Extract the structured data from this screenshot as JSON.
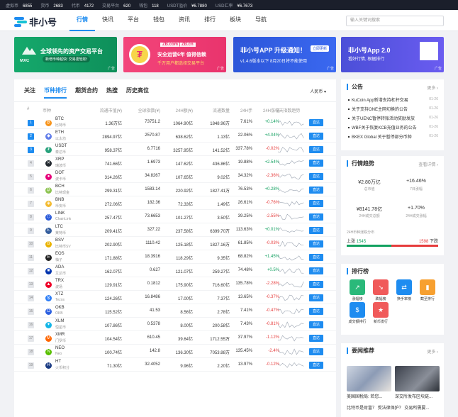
{
  "topbar": [
    {
      "label": "虚拟币",
      "value": "6855"
    },
    {
      "label": "货币",
      "value": "2683"
    },
    {
      "label": "代币",
      "value": "4172"
    },
    {
      "label": "交易平台",
      "value": "620"
    },
    {
      "label": "钱包",
      "value": "118"
    },
    {
      "label": "USDT溢价",
      "value": "¥6.7880"
    },
    {
      "label": "USD汇率",
      "value": "¥6.7673"
    }
  ],
  "logo": "非小号",
  "nav": [
    "行情",
    "快讯",
    "平台",
    "钱包",
    "资讯",
    "排行",
    "板块",
    "导航"
  ],
  "search_placeholder": "输入关键词搜索",
  "banners": {
    "b1": {
      "brand": "MXC",
      "title": "全球领先的资产交易平台",
      "sub": "新增币种超快! 交易更轻松!",
      "ad": "广告"
    },
    "b2": {
      "brand": "ZB.com | ZB.cn",
      "title": "安全运营6年 值得信赖",
      "sub": "千万用户都选择交易平台",
      "ad": "广告"
    },
    "b3": {
      "title": "非小号APP 升级通知！",
      "sub": "v1.4.6版本以下 8月20日将不能使用",
      "btn": "立即更新",
      "ad": "广告"
    },
    "b4": {
      "title": "非小号App 2.0",
      "sub": "看好行情, 根据排行",
      "ad": "广告"
    }
  },
  "tabs": [
    "关注",
    "币种排行",
    "期货合约",
    "热搜",
    "历史高位"
  ],
  "currency": "人民币",
  "headers": [
    "#",
    "币种",
    "流通市值(¥)",
    "全球指数(¥)",
    "24H额(¥)",
    "流通数量",
    "24H手",
    "24H涨幅",
    "7天指数趋势"
  ],
  "go_label": "直达",
  "rows": [
    {
      "rank": "1",
      "sym": "BTC",
      "name": "比特币",
      "cap": "1.36万亿",
      "price": "73751.2",
      "vol": "1064.90亿",
      "supply": "1848.96万",
      "turn": "7.61%",
      "chg": "+0.14%",
      "dir": "up",
      "color": "#f7931a",
      "ico": "₿"
    },
    {
      "rank": "2",
      "sym": "ETH",
      "name": "以太坊",
      "cap": "2894.97亿",
      "price": "2570.87",
      "vol": "638.62亿",
      "supply": "1.13亿",
      "turn": "22.06%",
      "chg": "+4.04%",
      "dir": "up",
      "color": "#627eea",
      "ico": "◆"
    },
    {
      "rank": "3",
      "sym": "USDT",
      "name": "泰达币",
      "cap": "958.37亿",
      "price": "6.7716",
      "vol": "3257.95亿",
      "supply": "141.52亿",
      "turn": "337.78%",
      "chg": "-0.02%",
      "dir": "down",
      "color": "#26a17b",
      "ico": "₮"
    },
    {
      "rank": "4",
      "sym": "XRP",
      "name": "瑞波币",
      "cap": "741.66亿",
      "price": "1.6973",
      "vol": "147.62亿",
      "supply": "436.86亿",
      "turn": "19.88%",
      "chg": "+2.54%",
      "dir": "up",
      "color": "#23292f",
      "ico": "✕"
    },
    {
      "rank": "5",
      "sym": "DOT",
      "name": "波卡币",
      "cap": "314.26亿",
      "price": "34.8267",
      "vol": "107.65亿",
      "supply": "9.02亿",
      "turn": "34.32%",
      "chg": "-2.36%",
      "dir": "down",
      "color": "#e6007a",
      "ico": "●"
    },
    {
      "rank": "6",
      "sym": "BCH",
      "name": "比特现金",
      "cap": "299.31亿",
      "price": "1583.14",
      "vol": "220.92亿",
      "supply": "1827.41万",
      "turn": "76.53%",
      "chg": "+0.28%",
      "dir": "up",
      "color": "#8dc351",
      "ico": "₿"
    },
    {
      "rank": "7",
      "sym": "BNB",
      "name": "币安币",
      "cap": "272.06亿",
      "price": "182.36",
      "vol": "72.33亿",
      "supply": "1.49亿",
      "turn": "26.61%",
      "chg": "-0.76%",
      "dir": "down",
      "color": "#f3ba2f",
      "ico": "◈"
    },
    {
      "rank": "8",
      "sym": "LINK",
      "name": "ChainLink",
      "cap": "257.47亿",
      "price": "73.6653",
      "vol": "101.27亿",
      "supply": "3.50亿",
      "turn": "39.25%",
      "chg": "-2.55%",
      "dir": "down",
      "color": "#2a5ada",
      "ico": "⬡"
    },
    {
      "rank": "9",
      "sym": "LTC",
      "name": "莱特币",
      "cap": "209.41亿",
      "price": "327.22",
      "vol": "237.58亿",
      "supply": "6399.70万",
      "turn": "113.63%",
      "chg": "+0.01%",
      "dir": "up",
      "color": "#345d9d",
      "ico": "Ł"
    },
    {
      "rank": "10",
      "sym": "BSV",
      "name": "比特币SV",
      "cap": "202.90亿",
      "price": "1110.42",
      "vol": "125.18亿",
      "supply": "1827.16万",
      "turn": "61.85%",
      "chg": "-0.03%",
      "dir": "down",
      "color": "#eab300",
      "ico": "B"
    },
    {
      "rank": "11",
      "sym": "EOS",
      "name": "柚子",
      "cap": "171.88亿",
      "price": "18.3916",
      "vol": "118.29亿",
      "supply": "9.35亿",
      "turn": "68.82%",
      "chg": "+1.45%",
      "dir": "up",
      "color": "#222",
      "ico": "E"
    },
    {
      "rank": "12",
      "sym": "ADA",
      "name": "艾达币",
      "cap": "162.07亿",
      "price": "0.627",
      "vol": "121.07亿",
      "supply": "259.27亿",
      "turn": "74.48%",
      "chg": "+0.5%",
      "dir": "up",
      "color": "#0033ad",
      "ico": "✺"
    },
    {
      "rank": "13",
      "sym": "TRX",
      "name": "波场",
      "cap": "129.91亿",
      "price": "0.1812",
      "vol": "175.90亿",
      "supply": "716.60亿",
      "turn": "135.78%",
      "chg": "-2.28%",
      "dir": "down",
      "color": "#ef0027",
      "ico": "▲"
    },
    {
      "rank": "14",
      "sym": "XTZ",
      "name": "Tezos",
      "cap": "124.26亿",
      "price": "16.8486",
      "vol": "17.00亿",
      "supply": "7.37亿",
      "turn": "13.65%",
      "chg": "-0.37%",
      "dir": "down",
      "color": "#2c7df7",
      "ico": "ꜩ"
    },
    {
      "rank": "15",
      "sym": "OKB",
      "name": "OKB",
      "cap": "115.52亿",
      "price": "41.53",
      "vol": "8.56亿",
      "supply": "2.78亿",
      "turn": "7.41%",
      "chg": "-0.47%",
      "dir": "down",
      "color": "#2d60e0",
      "ico": "O"
    },
    {
      "rank": "16",
      "sym": "XLM",
      "name": "恒星币",
      "cap": "107.86亿",
      "price": "0.5378",
      "vol": "8.00亿",
      "supply": "200.58亿",
      "turn": "7.43%",
      "chg": "-0.81%",
      "dir": "down",
      "color": "#14b6e7",
      "ico": "✦"
    },
    {
      "rank": "17",
      "sym": "XMR",
      "name": "门罗币",
      "cap": "104.54亿",
      "price": "610.45",
      "vol": "39.64亿",
      "supply": "1712.55万",
      "turn": "37.97%",
      "chg": "-1.12%",
      "dir": "down",
      "color": "#ff6600",
      "ico": "M"
    },
    {
      "rank": "18",
      "sym": "NEO",
      "name": "Neo",
      "cap": "100.74亿",
      "price": "142.8",
      "vol": "136.30亿",
      "supply": "7053.88万",
      "turn": "135.45%",
      "chg": "-2.4%",
      "dir": "down",
      "color": "#58bf00",
      "ico": "N"
    },
    {
      "rank": "19",
      "sym": "HT",
      "name": "火币积分",
      "cap": "71.30亿",
      "price": "32.4052",
      "vol": "9.96亿",
      "supply": "2.20亿",
      "turn": "13.97%",
      "chg": "-0.12%",
      "dir": "down",
      "color": "#1c3c84",
      "ico": "H"
    }
  ],
  "announce": {
    "title": "公告",
    "more": "更多",
    "items": [
      {
        "text": "KuCoin App新增支持杠杆交易",
        "date": "01-26"
      },
      {
        "text": "关于支持ONE主网切换的公告",
        "date": "01-26"
      },
      {
        "text": "关于UENC暂停转账活动奖励发放",
        "date": "01-26"
      },
      {
        "text": "WBF关于恢复KCB充值业务的公告",
        "date": "01-26"
      },
      {
        "text": "BKEX Global 关于暂停部分币种",
        "date": "01-26"
      }
    ]
  },
  "market": {
    "title": "行情趋势",
    "more": "查看详情",
    "m1": {
      "value": "¥2.80万亿",
      "label": "总市值"
    },
    "m2": {
      "value": "+16.46%",
      "label": "7日涨幅"
    },
    "m3": {
      "value": "¥8141.78亿",
      "label": "24H成交总额"
    },
    "m4": {
      "value": "+1.70%",
      "label": "24H成交涨幅"
    },
    "dist_label": "24H币种涨跌分布",
    "up_label": "上涨",
    "up_value": "1545",
    "down_label": "下跌",
    "down_value": "1598"
  },
  "ranking": {
    "title": "排行榜",
    "items": [
      {
        "label": "涨幅榜",
        "color": "#2ab97a",
        "ico": "↗"
      },
      {
        "label": "跌幅榜",
        "color": "#f05a5a",
        "ico": "↘"
      },
      {
        "label": "换手率榜",
        "color": "#1e8cf0",
        "ico": "⇄"
      },
      {
        "label": "截至排行",
        "color": "#f7a030",
        "ico": "▮"
      },
      {
        "label": "成交额排行",
        "color": "#1e8cf0",
        "ico": "$"
      },
      {
        "label": "新币发行",
        "color": "#f05a5a",
        "ico": "★"
      }
    ]
  },
  "news": {
    "title": "要闻推荐",
    "more": "更多",
    "items": [
      {
        "caption": "美国国税局: 若您..."
      },
      {
        "caption": "深交所发布区块链..."
      }
    ],
    "footer": "比特币是财富？ 受法律保护？ 交易所需要..."
  }
}
